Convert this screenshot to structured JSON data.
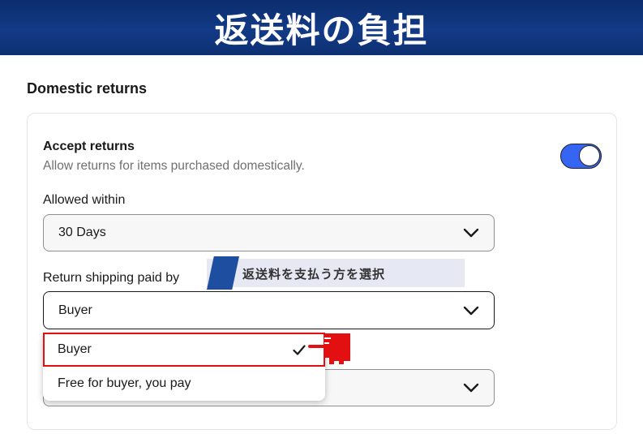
{
  "banner": {
    "title": "返送料の負担"
  },
  "section": {
    "title": "Domestic returns"
  },
  "accept": {
    "title": "Accept returns",
    "description": "Allow returns for items purchased domestically.",
    "toggle_on": true
  },
  "allowed_within": {
    "label": "Allowed within",
    "value": "30 Days"
  },
  "shipping": {
    "label": "Return shipping paid by",
    "value": "Buyer",
    "options": [
      "Buyer",
      "Free for buyer, you pay"
    ],
    "selected_option": "Buyer"
  },
  "annotation": {
    "text": "返送料を支払う方を選択"
  },
  "colors": {
    "accent": "#3665f3",
    "banner": "#123a86",
    "highlight": "#e21010"
  }
}
